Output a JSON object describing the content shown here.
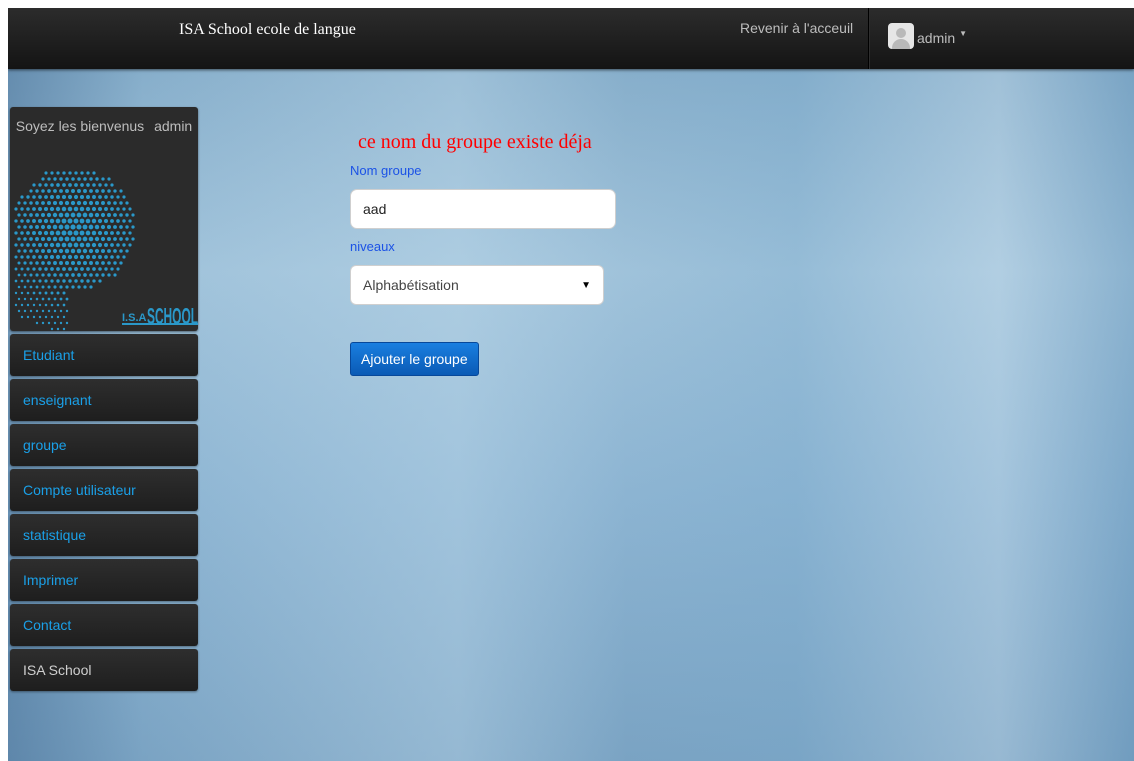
{
  "navbar": {
    "brand": "ISA School ecole de langue",
    "home_link": "Revenir à l'acceuil",
    "user": "admin"
  },
  "sidebar": {
    "welcome": "Soyez les bienvenus",
    "welcome_user": "admin",
    "logo_text": "I.S.A SCHOOL",
    "items": [
      {
        "label": "Etudiant"
      },
      {
        "label": "enseignant"
      },
      {
        "label": "groupe"
      },
      {
        "label": "Compte utilisateur"
      },
      {
        "label": "statistique"
      },
      {
        "label": "Imprimer"
      },
      {
        "label": "Contact"
      },
      {
        "label": "ISA School"
      }
    ]
  },
  "form": {
    "error": "ce nom du groupe existe déja",
    "name_label": "Nom groupe",
    "name_value": "aad",
    "level_label": "niveaux",
    "level_selected": "Alphabétisation",
    "submit_label": "Ajouter le groupe"
  },
  "colors": {
    "nav_bg": "#1c1c1c",
    "menu_link": "#1aa0e8",
    "error": "#ff0000",
    "label": "#1b52e6",
    "button": "#0e6ad0"
  }
}
